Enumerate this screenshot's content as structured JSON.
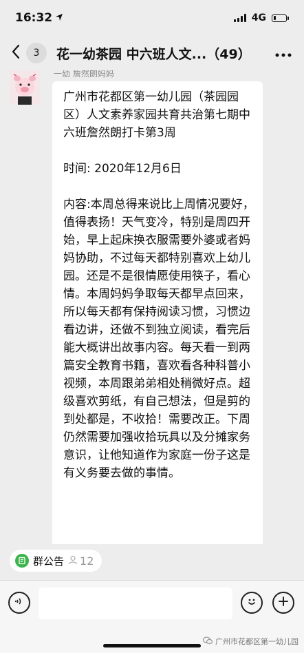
{
  "status_bar": {
    "time": "16:32",
    "network": "4G"
  },
  "header": {
    "unread_count": "3",
    "title": "花一幼茶园 中六班人文...（49）"
  },
  "message": {
    "sender": "一幼 詹然朗妈妈",
    "paragraphs": [
      "广州市花都区第一幼儿园（茶园园区）人文素养家园共育共治第七期中六班詹然朗打卡第3周",
      "时间: 2020年12月6日",
      "内容:本周总得来说比上周情况要好，值得表扬！天气变冷，特别是周四开始，早上起床换衣服需要外婆或者妈妈协助，不过每天都特别喜欢上幼儿园。还是不是很情愿使用筷子，看心情。本周妈妈争取每天都早点回来，所以每天都有保持阅读习惯，习惯边看边讲，还做不到独立阅读，看完后能大概讲出故事内容。每天看一到两篇安全教育书籍，喜欢看各种科普小视频，本周跟弟弟相处稍微好点。超级喜欢剪纸，有自己想法，但是剪的到处都是，不收拾！需要改正。下周仍然需要加强收拾玩具以及分摊家务意识，让他知道作为家庭一份子这是有义务要去做的事情。"
    ]
  },
  "group_notice": {
    "label": "群公告",
    "member_count": "12"
  },
  "input": {
    "value": ""
  },
  "watermark": {
    "text": "广州市花都区第一幼儿园"
  },
  "colors": {
    "background": "#ededed",
    "bubble": "#ffffff",
    "notice_icon": "#3cb44b"
  },
  "icons": [
    "location-arrow-icon",
    "signal-icon",
    "battery-icon",
    "back-chevron-icon",
    "more-icon",
    "notice-icon",
    "person-icon",
    "voice-icon",
    "emoji-icon",
    "plus-icon",
    "wechat-logo-icon"
  ]
}
